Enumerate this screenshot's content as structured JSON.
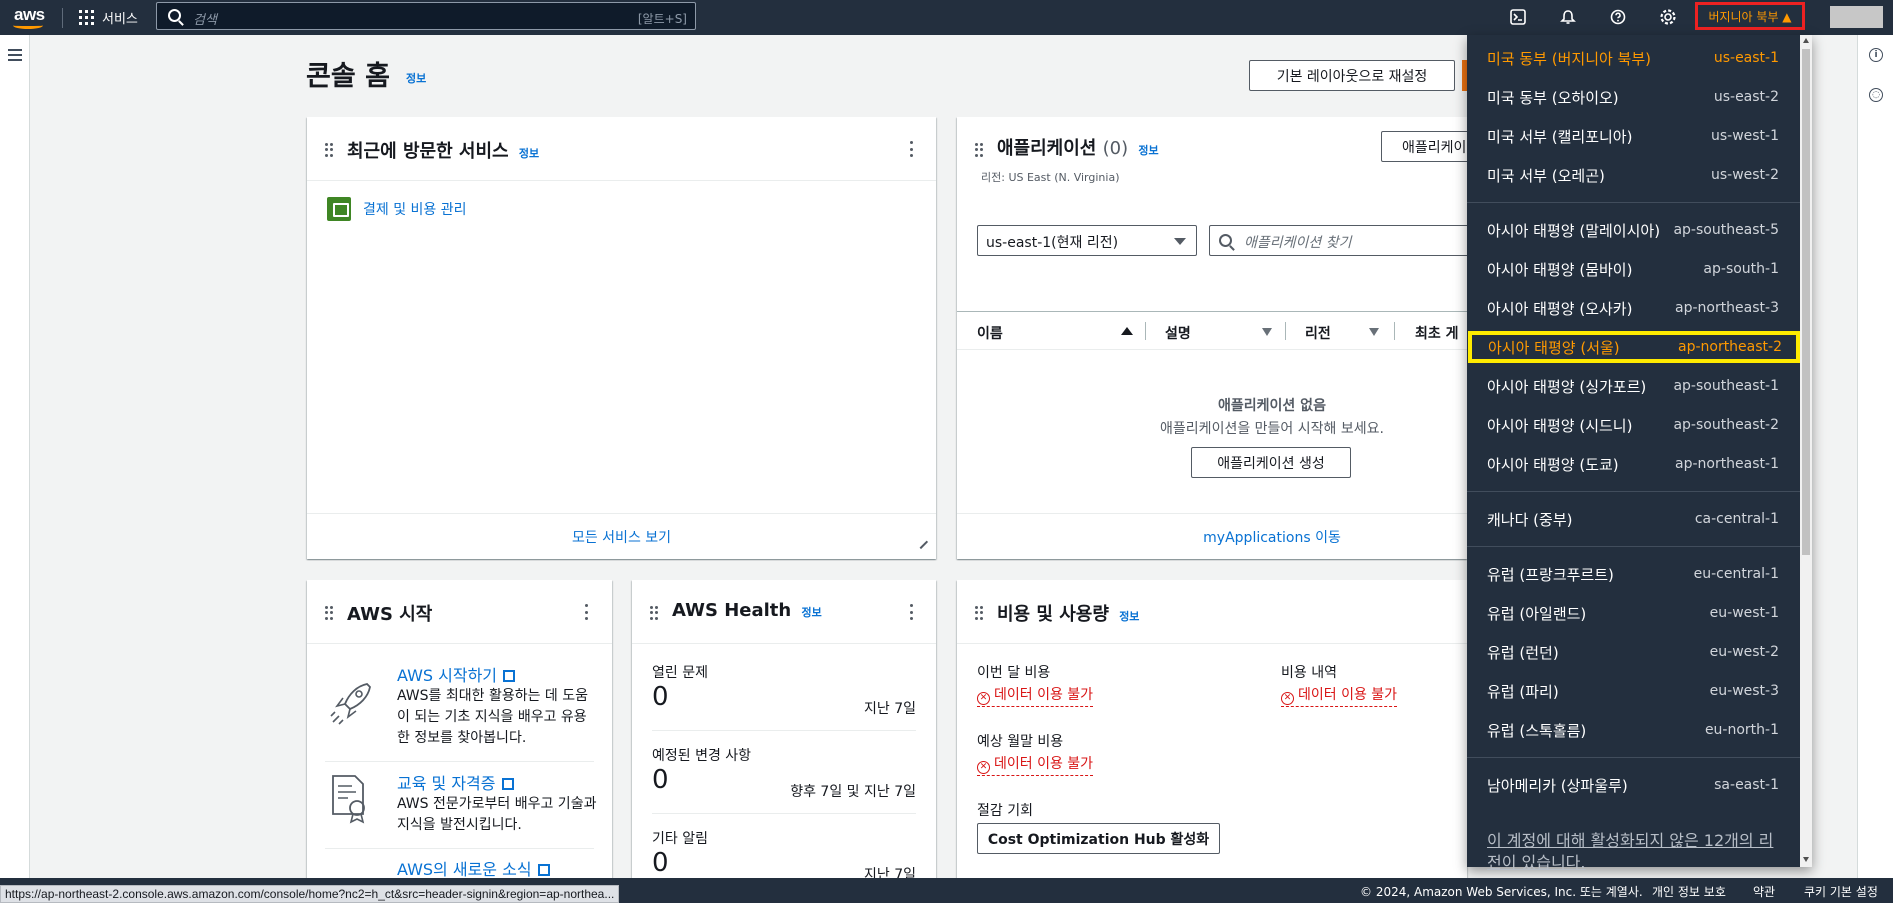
{
  "nav": {
    "logo": "aws",
    "services_label": "서비스",
    "search_placeholder": "검색",
    "search_shortcut": "[알트+S]",
    "region_label": "버지니아 북부 ▲"
  },
  "page": {
    "title": "콘솔 홈",
    "info": "정보",
    "reset_button": "기본 레이아웃으로 재설정"
  },
  "recent": {
    "title": "최근에 방문한 서비스",
    "info": "정보",
    "items": [
      {
        "label": "결제 및 비용 관리"
      }
    ],
    "footer_link": "모든 서비스 보기"
  },
  "apps": {
    "title": "애플리케이션",
    "count": "(0)",
    "info": "정보",
    "create_button_partial": "애플리케이",
    "region_note": "리전: US East (N. Virginia)",
    "region_select": "us-east-1(현재 리전)",
    "find_placeholder": "애플리케이션 찾기",
    "columns": [
      "이름",
      "설명",
      "리전",
      "최초 게"
    ],
    "empty_title": "애플리케이션 없음",
    "empty_desc": "애플리케이션을 만들어 시작해 보세요.",
    "create_app_button": "애플리케이션 생성",
    "footer_link": "myApplications 이동"
  },
  "getting_started": {
    "title": "AWS 시작",
    "items": [
      {
        "title": "AWS 시작하기",
        "body": "AWS를 최대한 활용하는 데 도움이 되는 기초 지식을 배우고 유용한 정보를 찾아봅니다."
      },
      {
        "title": "교육 및 자격증",
        "body": "AWS 전문가로부터 배우고 기술과 지식을 발전시킵니다."
      },
      {
        "title": "AWS의 새로운 소식",
        "body": ""
      }
    ]
  },
  "health": {
    "title": "AWS Health",
    "info": "정보",
    "rows": [
      {
        "label": "열린 문제",
        "value": "0",
        "period": "지난 7일"
      },
      {
        "label": "예정된 변경 사항",
        "value": "0",
        "period": "향후 7일 및 지난 7일"
      },
      {
        "label": "기타 알림",
        "value": "0",
        "period": "지난 7일"
      }
    ]
  },
  "cost": {
    "title": "비용 및 사용량",
    "info": "정보",
    "current_month_label": "이번 달 비용",
    "history_label": "비용 내역",
    "forecast_label": "예상 월말 비용",
    "unavailable": "데이터 이용 불가",
    "savings_label": "절감 기회",
    "hub_button": "Cost Optimization Hub 활성화"
  },
  "region_menu": {
    "groups": [
      [
        {
          "name": "미국 동부 (버지니아 북부)",
          "code": "us-east-1",
          "state": "current"
        },
        {
          "name": "미국 동부 (오하이오)",
          "code": "us-east-2"
        },
        {
          "name": "미국 서부 (캘리포니아)",
          "code": "us-west-1"
        },
        {
          "name": "미국 서부 (오레곤)",
          "code": "us-west-2"
        }
      ],
      [
        {
          "name": "아시아 태평양 (말레이시아)",
          "code": "ap-southeast-5"
        },
        {
          "name": "아시아 태평양 (뭄바이)",
          "code": "ap-south-1"
        },
        {
          "name": "아시아 태평양 (오사카)",
          "code": "ap-northeast-3"
        },
        {
          "name": "아시아 태평양 (서울)",
          "code": "ap-northeast-2",
          "state": "highlight"
        },
        {
          "name": "아시아 태평양 (싱가포르)",
          "code": "ap-southeast-1"
        },
        {
          "name": "아시아 태평양 (시드니)",
          "code": "ap-southeast-2"
        },
        {
          "name": "아시아 태평양 (도쿄)",
          "code": "ap-northeast-1"
        }
      ],
      [
        {
          "name": "캐나다 (중부)",
          "code": "ca-central-1"
        }
      ],
      [
        {
          "name": "유럽 (프랑크푸르트)",
          "code": "eu-central-1"
        },
        {
          "name": "유럽 (아일랜드)",
          "code": "eu-west-1"
        },
        {
          "name": "유럽 (런던)",
          "code": "eu-west-2"
        },
        {
          "name": "유럽 (파리)",
          "code": "eu-west-3"
        },
        {
          "name": "유럽 (스톡홀름)",
          "code": "eu-north-1"
        }
      ],
      [
        {
          "name": "남아메리카 (상파울루)",
          "code": "sa-east-1"
        }
      ]
    ],
    "disabled_note": "이 계정에 대해 활성화되지 않은 12개의 리전이 있습니다."
  },
  "footer": {
    "copyright": "© 2024, Amazon Web Services, Inc. 또는 계열사.",
    "privacy": "개인 정보 보호",
    "terms": "약관",
    "cookies": "쿠키 기본 설정"
  },
  "statusbar_url": "https://ap-northeast-2.console.aws.amazon.com/console/home?nc2=h_ct&src=header-signin&region=ap-northea...",
  "colors": {
    "nav_bg": "#232f3e",
    "accent": "#ff9900",
    "link": "#0972d3",
    "error": "#d91515",
    "highlight_border": "#ffeb00"
  }
}
